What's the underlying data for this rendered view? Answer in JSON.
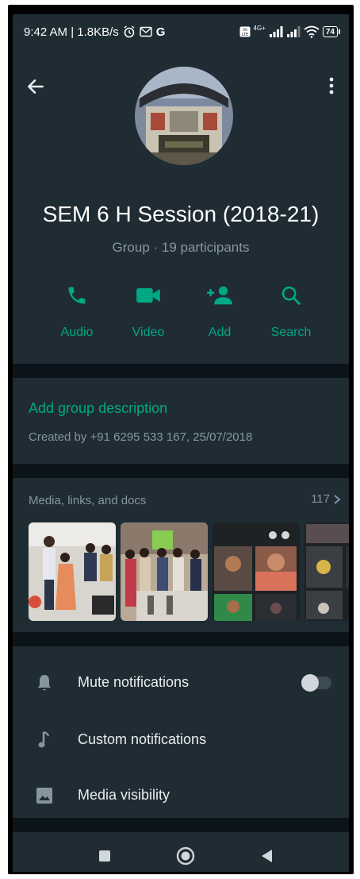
{
  "status_bar": {
    "time_speed": "9:42 AM | 1.8KB/s",
    "g_letter": "G",
    "network": "4G+",
    "battery": "74"
  },
  "header": {
    "group_name": "SEM 6 H Session (2018-21)",
    "group_info": "Group · 19 participants"
  },
  "actions": [
    {
      "label": "Audio",
      "icon": "phone-icon"
    },
    {
      "label": "Video",
      "icon": "video-camera-icon"
    },
    {
      "label": "Add",
      "icon": "add-person-icon"
    },
    {
      "label": "Search",
      "icon": "search-icon"
    }
  ],
  "description": {
    "add_label": "Add group description",
    "created": "Created by +91 6295 533 167, 25/07/2018"
  },
  "media": {
    "title": "Media, links, and docs",
    "count": "117"
  },
  "settings": [
    {
      "label": "Mute notifications",
      "icon": "bell-icon",
      "toggle": false
    },
    {
      "label": "Custom notifications",
      "icon": "music-note-icon"
    },
    {
      "label": "Media visibility",
      "icon": "image-icon"
    }
  ],
  "colors": {
    "accent": "#00a884",
    "panel": "#1f2c33",
    "background": "#0b141a",
    "secondary_text": "#8696a0"
  }
}
